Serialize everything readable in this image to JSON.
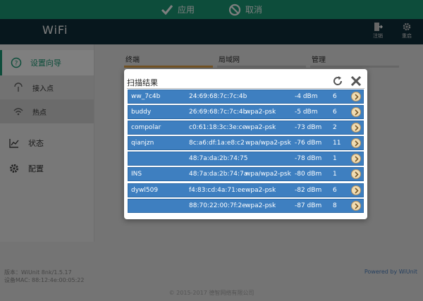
{
  "actionbar": {
    "apply_label": "应用",
    "cancel_label": "取消",
    "accent": "#1a9a76"
  },
  "header": {
    "brand": "WiFi",
    "logout_label": "注销",
    "reboot_label": "重启"
  },
  "sidebar": {
    "items": [
      {
        "label": "设置向导",
        "icon": "help-circle-icon"
      },
      {
        "label": "接入点",
        "icon": "antenna-icon"
      },
      {
        "label": "热点",
        "icon": "wifi-icon"
      },
      {
        "label": "状态",
        "icon": "chart-icon"
      },
      {
        "label": "配置",
        "icon": "gear-icon"
      }
    ]
  },
  "tabs": [
    "终端",
    "局域网",
    "管理"
  ],
  "footer": {
    "version": "版本：WiUnit 8nk/1.5.17",
    "mac": "设备MAC: 88:12:4e:00:05:22",
    "powered": "Powered by WiUnit",
    "copyright": "© 2015-2017 德智网络有限公司"
  },
  "dialog": {
    "title": "扫描结果",
    "rows": [
      {
        "ssid": "ww_7c4b",
        "mac": "24:69:68:7c:7c:4b",
        "security": "",
        "signal": "-4 dBm",
        "channel": "6"
      },
      {
        "ssid": "buddy",
        "mac": "26:69:68:7c:7c:4b",
        "security": "wpa2-psk",
        "signal": "-5 dBm",
        "channel": "6"
      },
      {
        "ssid": "compolar",
        "mac": "c0:61:18:3c:3e:ce",
        "security": "wpa2-psk",
        "signal": "-73 dBm",
        "channel": "2"
      },
      {
        "ssid": "qianjzn",
        "mac": "8c:a6:df:1a:e8:c2",
        "security": "wpa/wpa2-psk",
        "signal": "-76 dBm",
        "channel": "11"
      },
      {
        "ssid": "",
        "mac": "48:7a:da:2b:74:75",
        "security": "",
        "signal": "-78 dBm",
        "channel": "1"
      },
      {
        "ssid": "INS",
        "mac": "48:7a:da:2b:74:7a",
        "security": "wpa/wpa2-psk",
        "signal": "-80 dBm",
        "channel": "1"
      },
      {
        "ssid": "dywl509",
        "mac": "f4:83:cd:4a:71:ee",
        "security": "wpa2-psk",
        "signal": "-82 dBm",
        "channel": "6"
      },
      {
        "ssid": "",
        "mac": "88:70:22:00:7f:2e",
        "security": "wpa2-psk",
        "signal": "-87 dBm",
        "channel": "8"
      }
    ]
  }
}
